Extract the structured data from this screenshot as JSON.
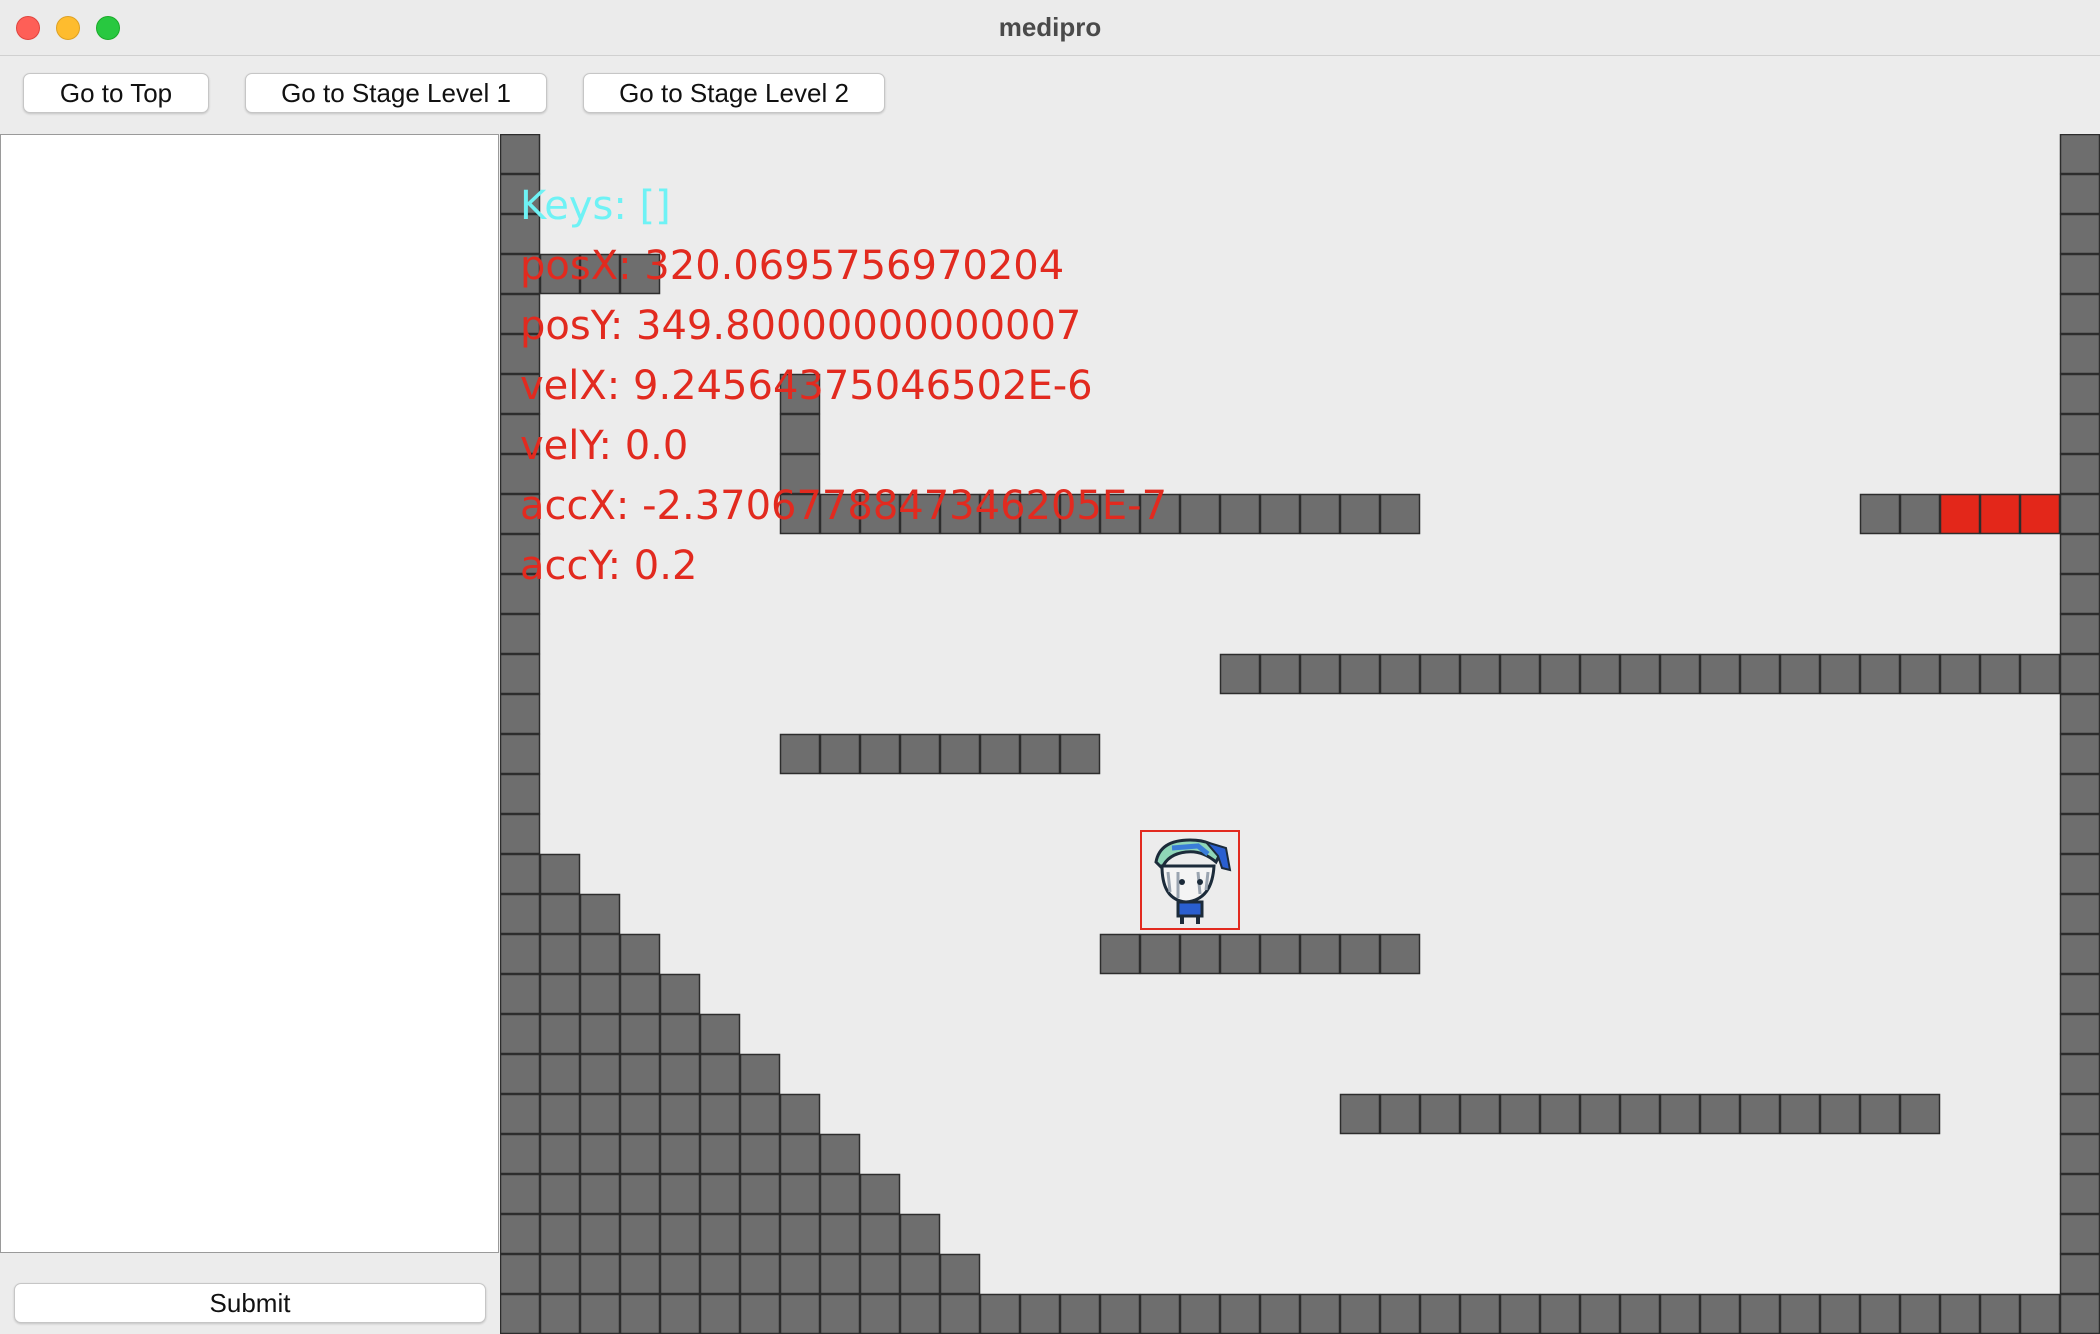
{
  "window": {
    "title": "medipro"
  },
  "toolbar": {
    "go_top": "Go to Top",
    "go_stage1": "Go to Stage Level 1",
    "go_stage2": "Go to Stage Level 2"
  },
  "sidebar": {
    "text_value": "",
    "submit": "Submit"
  },
  "hud": {
    "keys": "Keys: []",
    "posX": "posX: 320.0695756970204",
    "posY": "posY: 349.80000000000007",
    "velX": "velX: 9.24564375046502E-6",
    "velY": "velY: 0.0",
    "accX": "accX: -2.3706778847346205E-7",
    "accY": "accY: 0.2"
  },
  "colors": {
    "block": "#6e6e6e",
    "block_border": "#2d2d2d",
    "goal_block": "#e3271a",
    "background": "#ececec",
    "hud_keys": "#6ef2f5",
    "hud_values": "#e22a1f"
  },
  "game": {
    "cols": 40,
    "rows": 30,
    "tiles": {
      "left_wall": {
        "col": 0,
        "rows": [
          0,
          29
        ]
      },
      "right_wall": {
        "col": 39,
        "rows": [
          0,
          29
        ]
      },
      "floor": {
        "row": 29,
        "cols": [
          0,
          39
        ]
      },
      "platforms": [
        {
          "row": 3,
          "cols": [
            1,
            3
          ]
        },
        {
          "row": 9,
          "cols": [
            7,
            22
          ]
        },
        {
          "row": 9,
          "cols": [
            34,
            35
          ]
        },
        {
          "row": 13,
          "cols": [
            18,
            38
          ]
        },
        {
          "row": 15,
          "cols": [
            7,
            14
          ]
        },
        {
          "row": 20,
          "cols": [
            15,
            22
          ]
        },
        {
          "row": 24,
          "cols": [
            21,
            35
          ]
        }
      ],
      "pillar": {
        "col": 7,
        "rows": [
          6,
          8
        ]
      },
      "goal": {
        "row": 9,
        "cols": [
          36,
          38
        ]
      },
      "staircase": {
        "top_row": 18,
        "bottom_row": 28,
        "first_width": 1,
        "width_step": 1
      }
    },
    "player": {
      "sprite": "player-character",
      "col": 16,
      "row": 18
    }
  }
}
